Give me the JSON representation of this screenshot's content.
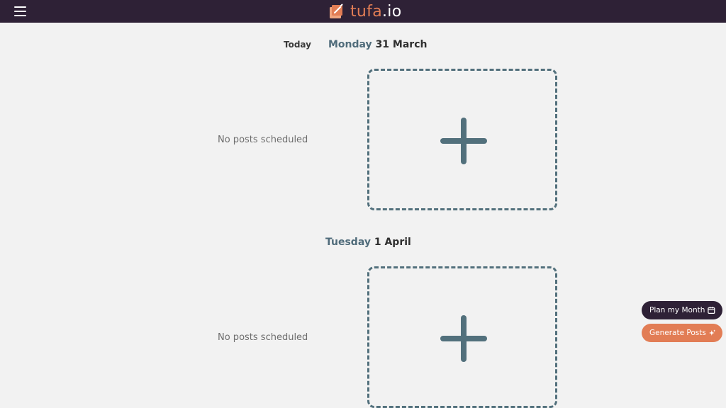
{
  "app": {
    "name_part1": "tufa",
    "name_part2": ".io",
    "accent_color": "#e27d55",
    "header_color": "#2e2136"
  },
  "header": {
    "menu_icon": "hamburger-menu-icon",
    "logo_icon": "tufa-logo-icon"
  },
  "schedule": {
    "today_label": "Today",
    "days": [
      {
        "weekday": "Monday",
        "date": "31 March",
        "empty_text": "No posts scheduled"
      },
      {
        "weekday": "Tuesday",
        "date": "1 April",
        "empty_text": "No posts scheduled"
      }
    ]
  },
  "actions": {
    "plan_month_label": "Plan my Month",
    "plan_month_icon": "calendar-icon",
    "generate_posts_label": "Generate Posts",
    "generate_posts_icon": "sparkle-icon"
  }
}
